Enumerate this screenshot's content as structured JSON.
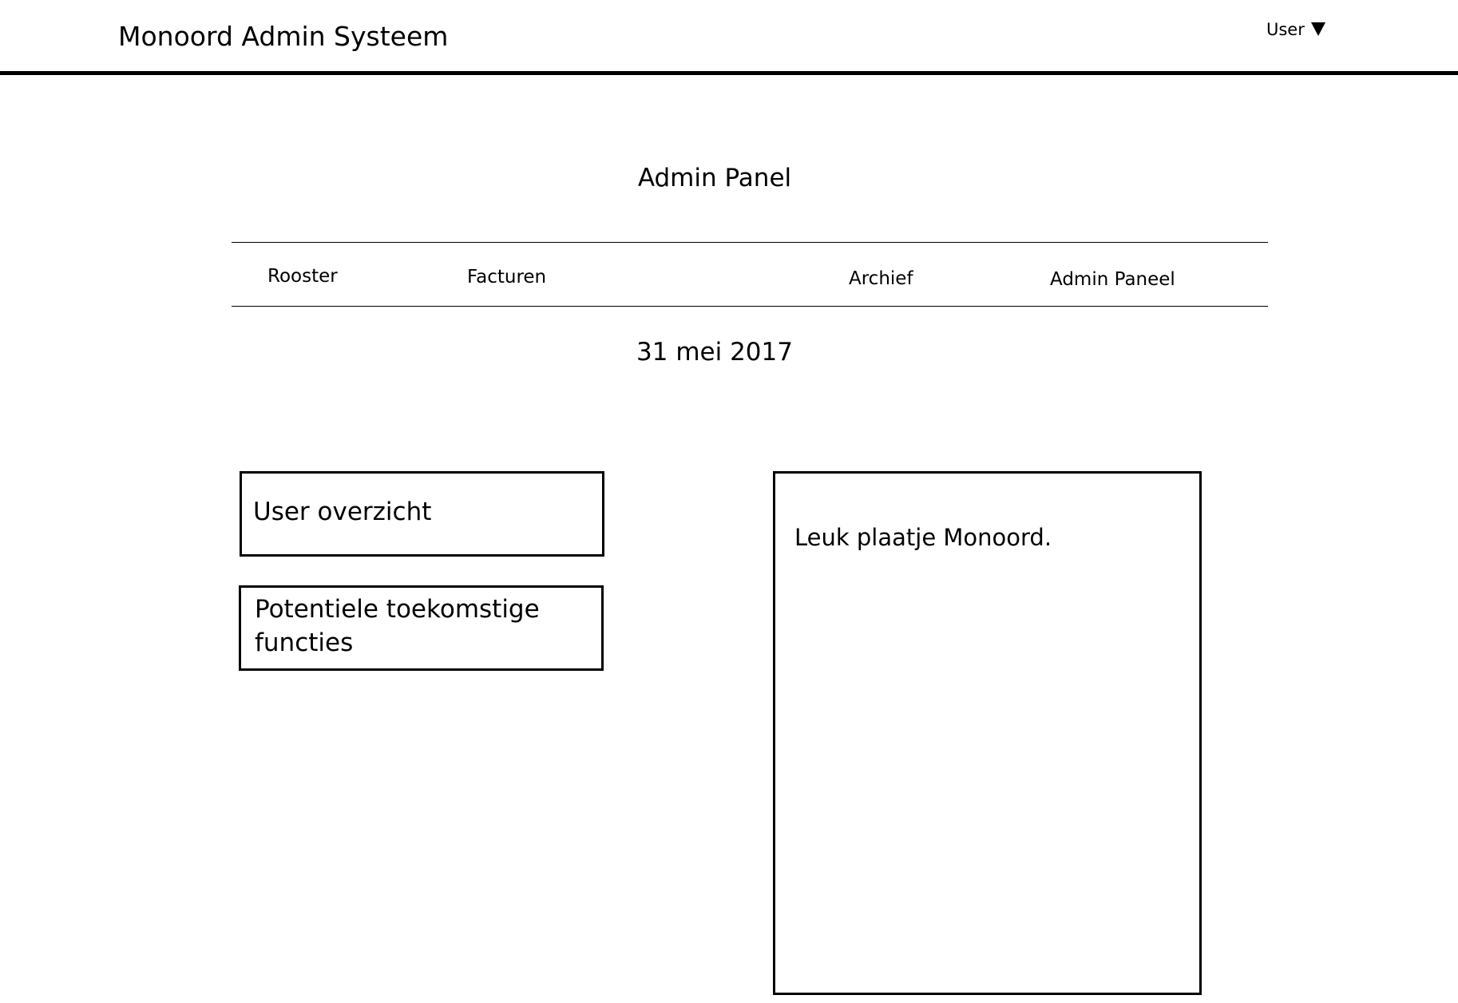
{
  "header": {
    "app_title": "Monoord Admin Systeem",
    "user_menu_label": "User",
    "user_menu_icon": "caret-down-icon"
  },
  "page": {
    "title": "Admin Panel",
    "date": "31 mei 2017"
  },
  "nav": {
    "items": [
      {
        "label": "Rooster"
      },
      {
        "label": "Facturen"
      },
      {
        "label": "Archief"
      },
      {
        "label": "Admin Paneel"
      }
    ]
  },
  "tiles": [
    {
      "label": "User overzicht"
    },
    {
      "label": "Potentiele toekomstige functies"
    }
  ],
  "image_placeholder": {
    "caption": "Leuk plaatje Monoord."
  },
  "colors": {
    "background": "#ffffff",
    "foreground": "#000000"
  }
}
